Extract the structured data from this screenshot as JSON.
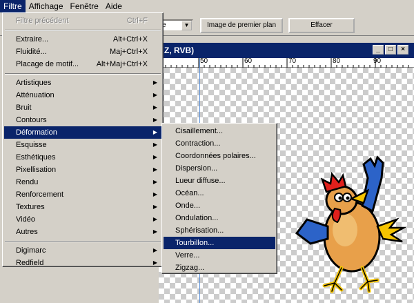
{
  "menubar": {
    "items": [
      "Filtre",
      "Affichage",
      "Fenêtre",
      "Aide"
    ]
  },
  "options_bar": {
    "select_value": "e",
    "btn_foreground": "Image de premier plan",
    "btn_clear": "Effacer"
  },
  "document": {
    "title": "Z, RVB)",
    "ruler_ticks": [
      "50",
      "60",
      "70",
      "80",
      "90"
    ]
  },
  "filter_menu": {
    "last_filter": {
      "label": "Filtre précédent",
      "shortcut": "Ctrl+F"
    },
    "top_items": [
      {
        "label": "Extraire...",
        "shortcut": "Alt+Ctrl+X"
      },
      {
        "label": "Fluidité...",
        "shortcut": "Maj+Ctrl+X"
      },
      {
        "label": "Placage de motif...",
        "shortcut": "Alt+Maj+Ctrl+X"
      }
    ],
    "categories": [
      "Artistiques",
      "Atténuation",
      "Bruit",
      "Contours",
      "Déformation",
      "Esquisse",
      "Esthétiques",
      "Pixellisation",
      "Rendu",
      "Renforcement",
      "Textures",
      "Vidéo",
      "Autres"
    ],
    "plugins": [
      "Digimarc",
      "Redfield"
    ]
  },
  "deformation_submenu": {
    "items": [
      "Cisaillement...",
      "Contraction...",
      "Coordonnées polaires...",
      "Dispersion...",
      "Lueur diffuse...",
      "Océan...",
      "Onde...",
      "Ondulation...",
      "Sphérisation...",
      "Tourbillon...",
      "Verre...",
      "Zigzag..."
    ]
  },
  "colors": {
    "highlight": "#0a246a",
    "menu_bg": "#d4d0c8"
  }
}
